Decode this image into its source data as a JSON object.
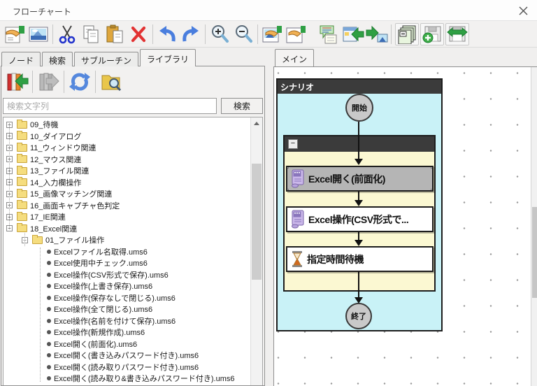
{
  "window": {
    "title": "フローチャート"
  },
  "toolbar": {
    "icons": [
      "new-flowchart",
      "image",
      "cut",
      "copy",
      "paste",
      "delete",
      "undo",
      "redo",
      "zoom-in",
      "zoom-out",
      "edit-image",
      "edit-page",
      "comment",
      "import-window",
      "export-image",
      "page-stack",
      "save-add",
      "save-sync"
    ]
  },
  "left_panel": {
    "tabs": [
      "ノード",
      "検索",
      "サブルーチン",
      "ライブラリ"
    ],
    "active_tab": "ライブラリ",
    "library_toolbar": [
      "import-library",
      "export-library",
      "reload-library",
      "library-folder-search"
    ],
    "search": {
      "placeholder": "検索文字列",
      "button_label": "検索"
    },
    "tree": [
      {
        "label": "09_待機",
        "type": "folder",
        "expander": "+"
      },
      {
        "label": "10_ダイアログ",
        "type": "folder",
        "expander": "+"
      },
      {
        "label": "11_ウィンドウ関連",
        "type": "folder",
        "expander": "+"
      },
      {
        "label": "12_マウス関連",
        "type": "folder",
        "expander": "+"
      },
      {
        "label": "13_ファイル関連",
        "type": "folder",
        "expander": "+"
      },
      {
        "label": "14_入力欄操作",
        "type": "folder",
        "expander": "+"
      },
      {
        "label": "15_画像マッチング関連",
        "type": "folder",
        "expander": "+"
      },
      {
        "label": "16_画面キャプチャ色判定",
        "type": "folder",
        "expander": "+"
      },
      {
        "label": "17_IE関連",
        "type": "folder",
        "expander": "+"
      },
      {
        "label": "18_Excel関連",
        "type": "folder",
        "expander": "−"
      },
      {
        "label": "01_ファイル操作",
        "type": "folder",
        "expander": "−"
      },
      {
        "label": "Excelファイル名取得.ums6",
        "type": "file"
      },
      {
        "label": "Excel使用中チェック.ums6",
        "type": "file"
      },
      {
        "label": "Excel操作(CSV形式で保存).ums6",
        "type": "file"
      },
      {
        "label": "Excel操作(上書き保存).ums6",
        "type": "file"
      },
      {
        "label": "Excel操作(保存なしで閉じる).ums6",
        "type": "file"
      },
      {
        "label": "Excel操作(全て閉じる).ums6",
        "type": "file"
      },
      {
        "label": "Excel操作(名前を付けて保存).ums6",
        "type": "file"
      },
      {
        "label": "Excel操作(新規作成).ums6",
        "type": "file"
      },
      {
        "label": "Excel開く(前面化).ums6",
        "type": "file"
      },
      {
        "label": "Excel開く(書き込みパスワード付き).ums6",
        "type": "file"
      },
      {
        "label": "Excel開く(読み取りパスワード付き).ums6",
        "type": "file"
      },
      {
        "label": "Excel開く(読み取り&書き込みパスワード付き).ums6",
        "type": "file"
      }
    ]
  },
  "main_panel": {
    "tab": "メイン",
    "flowchart": {
      "scenario_title": "シナリオ",
      "start_label": "開始",
      "end_label": "終了",
      "collapse_label": "−",
      "nodes": [
        {
          "label": "Excel開く(前面化)",
          "icon": "script",
          "selected": true
        },
        {
          "label": "Excel操作(CSV形式で...",
          "icon": "script",
          "selected": false
        },
        {
          "label": "指定時間待機",
          "icon": "hourglass",
          "selected": false
        }
      ]
    }
  },
  "colors": {
    "scenario_body": "#c9f2f7",
    "group_body": "#fbf8d2",
    "header_dark": "#3b3b3b",
    "selected_node": "#b5b5b5",
    "accent_green": "#2fa044",
    "accent_blue": "#4a7ede"
  }
}
